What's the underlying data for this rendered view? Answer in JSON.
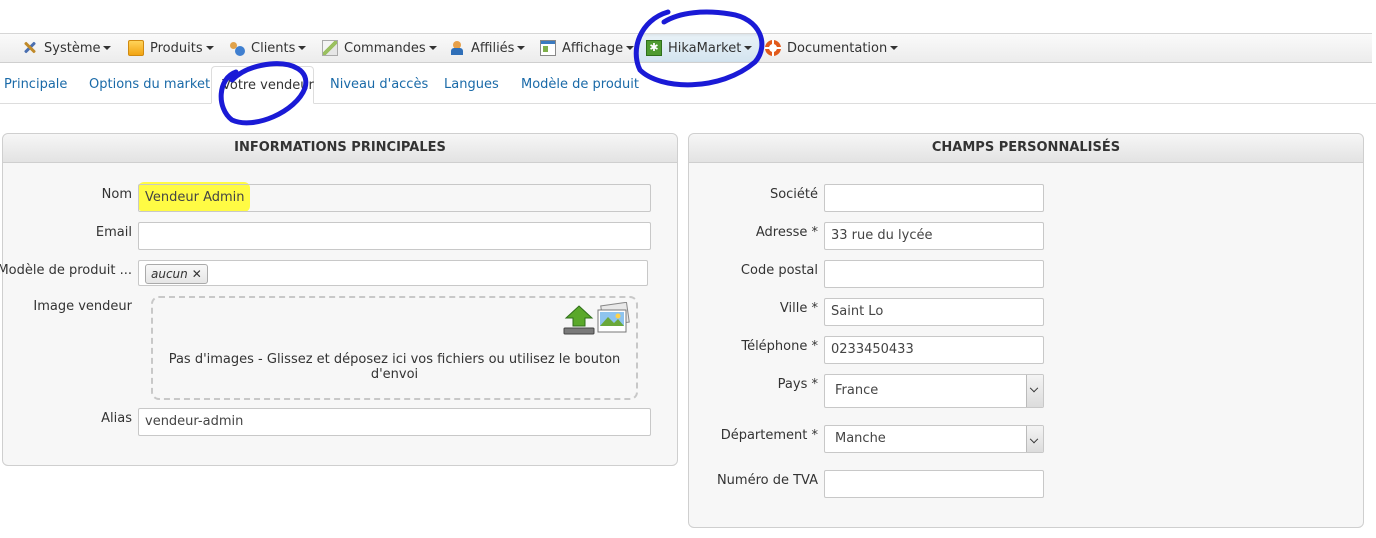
{
  "menu": [
    {
      "label": "Système",
      "icon": "tools-icon"
    },
    {
      "label": "Produits",
      "icon": "box-icon"
    },
    {
      "label": "Clients",
      "icon": "users-icon"
    },
    {
      "label": "Commandes",
      "icon": "orders-icon"
    },
    {
      "label": "Affiliés",
      "icon": "affiliates-icon"
    },
    {
      "label": "Affichage",
      "icon": "display-icon"
    },
    {
      "label": "HikaMarket",
      "icon": "hikamarket-icon",
      "active": true
    },
    {
      "label": "Documentation",
      "icon": "help-lifebuoy-icon"
    }
  ],
  "tabs": [
    {
      "label": "Principale"
    },
    {
      "label": "Options du market"
    },
    {
      "label": "Votre vendeur",
      "active": true
    },
    {
      "label": "Niveau d'accès"
    },
    {
      "label": "Langues"
    },
    {
      "label": "Modèle de produit"
    }
  ],
  "main_panel": {
    "title": "INFORMATIONS PRINCIPALES",
    "name_label": "Nom",
    "name_value": "Vendeur Admin",
    "email_label": "Email",
    "email_value": "",
    "template_label": "Modèle de produit ...",
    "template_tag": "aucun",
    "tag_remove": "✕",
    "image_label": "Image vendeur",
    "dropzone_text": "Pas d'images - Glissez et déposez ici vos fichiers ou utilisez le bouton d'envoi",
    "alias_label": "Alias",
    "alias_value": "vendeur-admin"
  },
  "custom_panel": {
    "title": "CHAMPS PERSONNALISÉS",
    "company_label": "Société",
    "company_value": "",
    "address_label": "Adresse *",
    "address_value": "33 rue du lycée",
    "zip_label": "Code postal",
    "zip_value": "",
    "city_label": "Ville *",
    "city_value": "Saint Lo",
    "phone_label": "Téléphone *",
    "phone_value": "0233450433",
    "country_label": "Pays *",
    "country_value": "France",
    "dept_label": "Département *",
    "dept_value": "Manche",
    "vat_label": "Numéro de TVA",
    "vat_value": ""
  },
  "colors": {
    "annotation_circle": "#1a1ad6",
    "highlight": "#fffb3a",
    "link": "#1a6aa8"
  }
}
